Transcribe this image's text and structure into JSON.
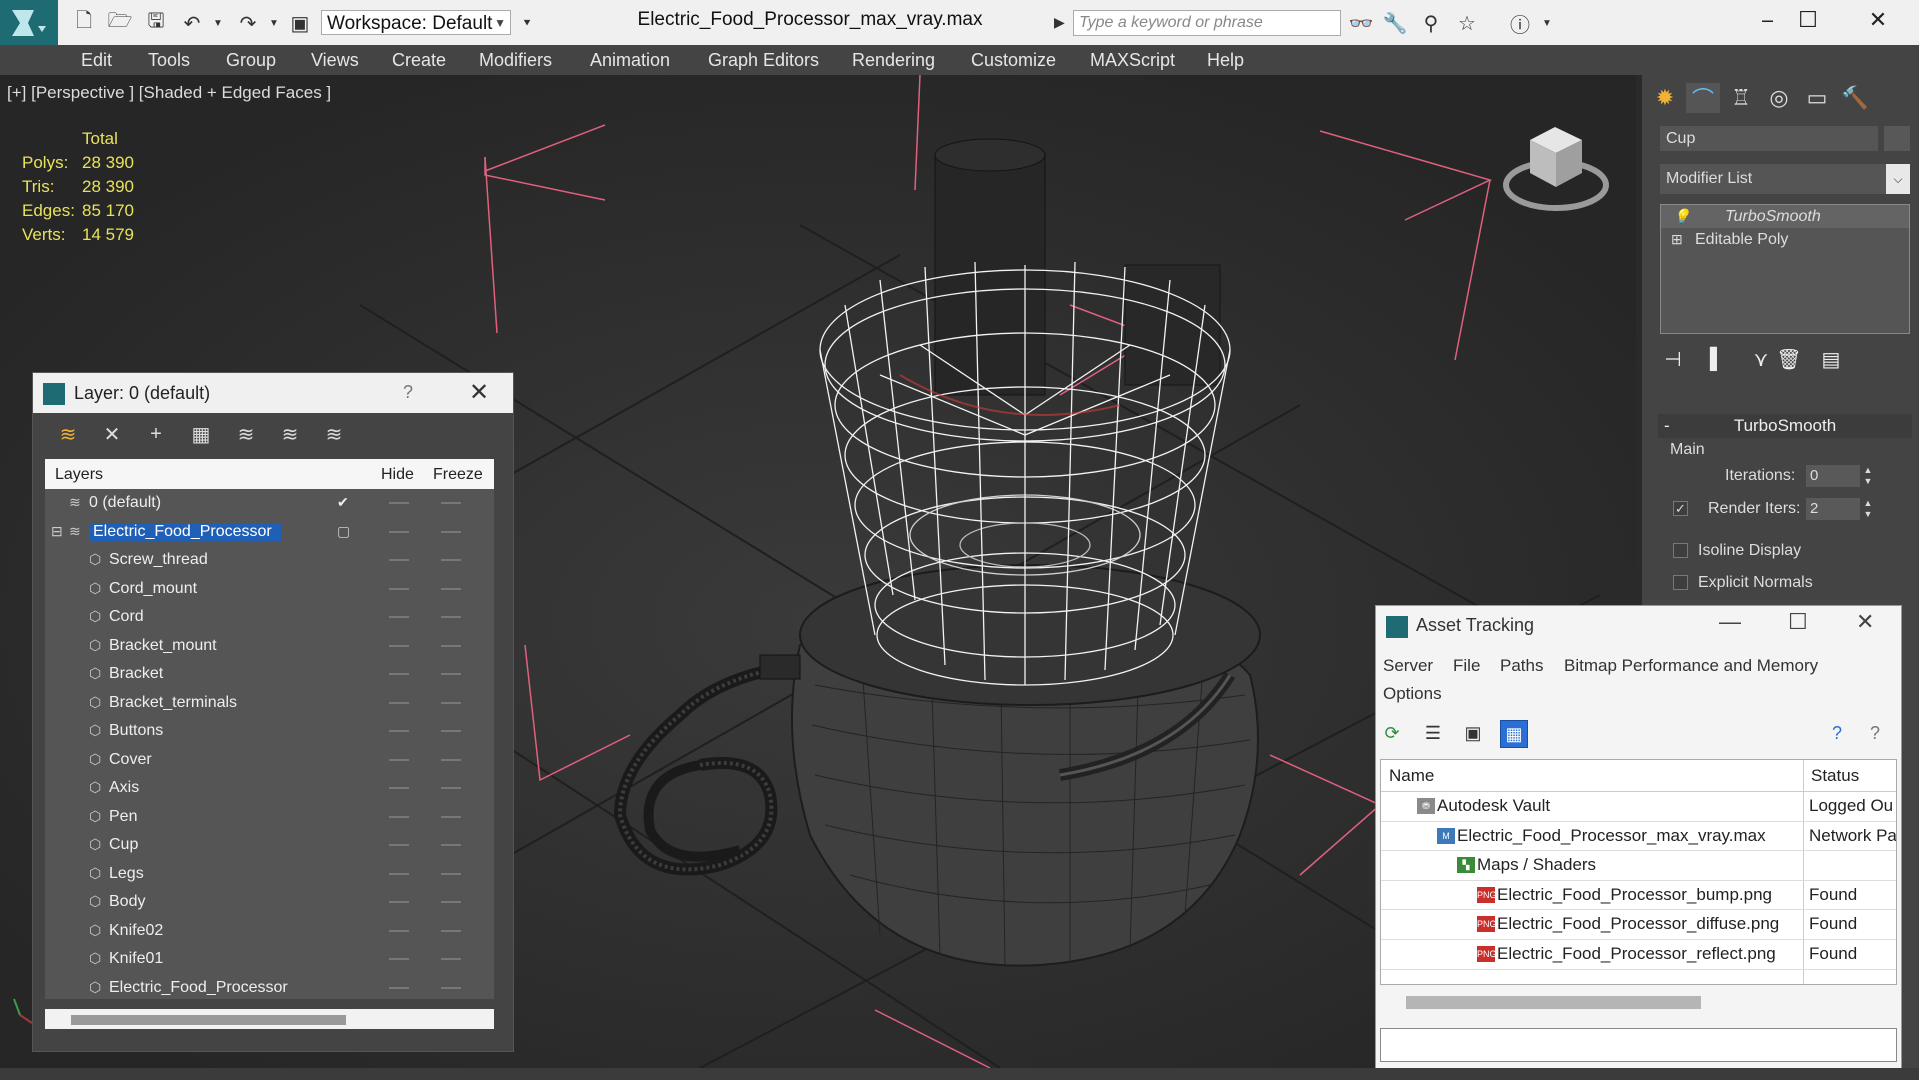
{
  "window": {
    "title": "Electric_Food_Processor_max_vray.max",
    "workspace_label": "Workspace: Default",
    "search_placeholder": "Type a keyword or phrase",
    "minimize": "—",
    "maximize": "☐",
    "close": "✕"
  },
  "menu": [
    "Edit",
    "Tools",
    "Group",
    "Views",
    "Create",
    "Modifiers",
    "Animation",
    "Graph Editors",
    "Rendering",
    "Customize",
    "MAXScript",
    "Help"
  ],
  "viewport": {
    "label": "[+] [Perspective ] [Shaded + Edged Faces ]",
    "stats_header": "Total",
    "stats": [
      {
        "label": "Polys:",
        "value": "28 390"
      },
      {
        "label": "Tris:",
        "value": "28 390"
      },
      {
        "label": "Edges:",
        "value": "85 170"
      },
      {
        "label": "Verts:",
        "value": "14 579"
      }
    ]
  },
  "command_panel": {
    "object_name": "Cup",
    "modifier_list": "Modifier List",
    "stack": [
      {
        "label": "TurboSmooth",
        "selected": true
      },
      {
        "label": "Editable Poly",
        "selected": false
      }
    ],
    "rollout_title": "TurboSmooth",
    "rollout_minus": "-",
    "group_main": "Main",
    "iterations_label": "Iterations:",
    "iterations_value": "0",
    "render_iters_label": "Render Iters:",
    "render_iters_value": "2",
    "render_iters_checked": true,
    "isoline_label": "Isoline Display",
    "explicit_normals_label": "Explicit Normals"
  },
  "layer_explorer": {
    "title": "Layer: 0 (default)",
    "help": "?",
    "close": "✕",
    "columns": {
      "layers": "Layers",
      "hide": "Hide",
      "freeze": "Freeze"
    },
    "rows": [
      {
        "name": "0 (default)",
        "level": 0,
        "type": "layer",
        "current": true
      },
      {
        "name": "Electric_Food_Processor",
        "level": 0,
        "type": "layer",
        "selected": true
      },
      {
        "name": "Screw_thread",
        "level": 1,
        "type": "object"
      },
      {
        "name": "Cord_mount",
        "level": 1,
        "type": "object"
      },
      {
        "name": "Cord",
        "level": 1,
        "type": "object"
      },
      {
        "name": "Bracket_mount",
        "level": 1,
        "type": "object"
      },
      {
        "name": "Bracket",
        "level": 1,
        "type": "object"
      },
      {
        "name": "Bracket_terminals",
        "level": 1,
        "type": "object"
      },
      {
        "name": "Buttons",
        "level": 1,
        "type": "object"
      },
      {
        "name": "Cover",
        "level": 1,
        "type": "object"
      },
      {
        "name": "Axis",
        "level": 1,
        "type": "object"
      },
      {
        "name": "Pen",
        "level": 1,
        "type": "object"
      },
      {
        "name": "Cup",
        "level": 1,
        "type": "object"
      },
      {
        "name": "Legs",
        "level": 1,
        "type": "object"
      },
      {
        "name": "Body",
        "level": 1,
        "type": "object"
      },
      {
        "name": "Knife02",
        "level": 1,
        "type": "object"
      },
      {
        "name": "Knife01",
        "level": 1,
        "type": "object"
      },
      {
        "name": "Electric_Food_Processor",
        "level": 1,
        "type": "object"
      }
    ]
  },
  "asset_tracking": {
    "title": "Asset Tracking",
    "menu": [
      "Server",
      "File",
      "Paths",
      "Bitmap Performance and Memory",
      "Options"
    ],
    "columns": {
      "name": "Name",
      "status": "Status"
    },
    "rows": [
      {
        "name": "Autodesk Vault",
        "status": "Logged Ou",
        "icon": "vault-icon"
      },
      {
        "name": "Electric_Food_Processor_max_vray.max",
        "status": "Network Pa",
        "icon": "max-file-icon"
      },
      {
        "name": "Maps / Shaders",
        "status": "",
        "icon": "maps-icon"
      },
      {
        "name": "Electric_Food_Processor_bump.png",
        "status": "Found",
        "icon": "png-icon"
      },
      {
        "name": "Electric_Food_Processor_diffuse.png",
        "status": "Found",
        "icon": "png-icon"
      },
      {
        "name": "Electric_Food_Processor_reflect.png",
        "status": "Found",
        "icon": "png-icon"
      }
    ]
  },
  "colors": {
    "stats_yellow": "#e8e25a",
    "selection_blue": "#1f5fb5",
    "bounding_box_pink": "#e0607e",
    "app_teal": "#1f6b73"
  }
}
